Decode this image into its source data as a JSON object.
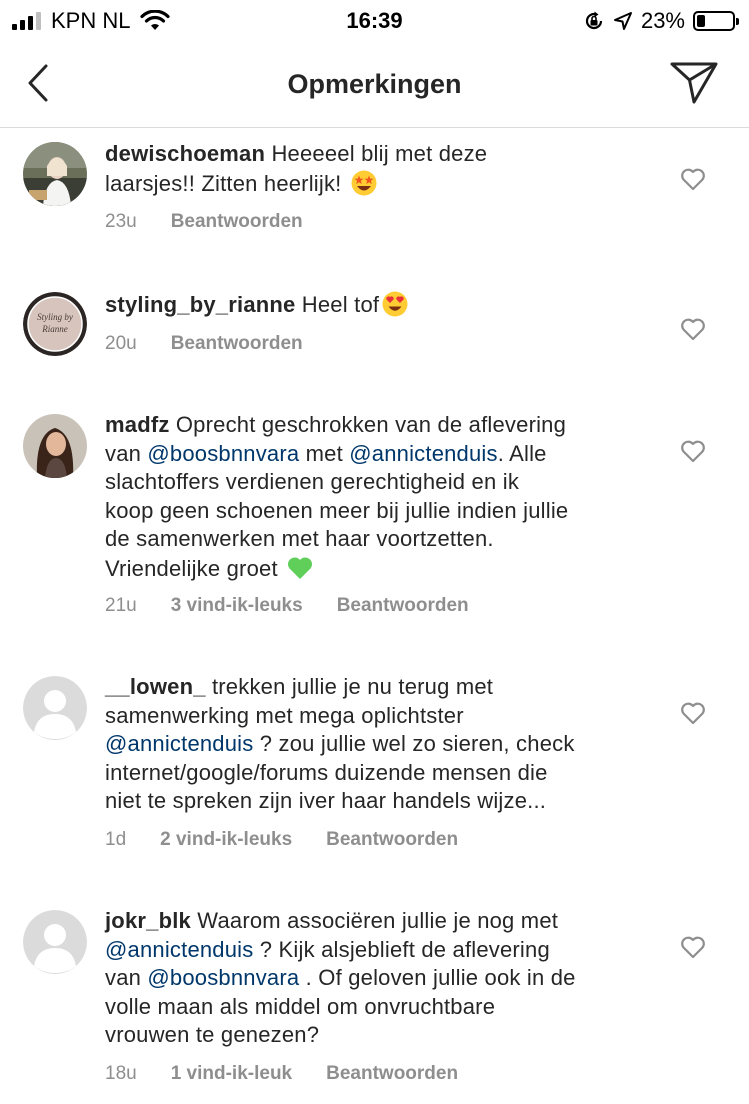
{
  "status_bar": {
    "carrier": "KPN NL",
    "time": "16:39",
    "battery_percent": "23%",
    "battery_level": 0.23,
    "icons": [
      "signal-icon",
      "wifi-icon",
      "orientation-lock-icon",
      "location-arrow-icon",
      "battery-icon"
    ]
  },
  "header": {
    "title": "Opmerkingen",
    "back_icon": "chevron-left-icon",
    "send_icon": "paper-plane-icon"
  },
  "comments": [
    {
      "username": "dewischoeman",
      "text_parts": [
        "Heeeeel blij met deze",
        "laarsjes!! Zitten heerlijk!"
      ],
      "emoji": "star-struck-emoji",
      "time": "23u",
      "likes": "",
      "reply_label": "Beantwoorden"
    },
    {
      "username": "styling_by_rianne",
      "text": "Heel tof",
      "emoji": "heart-eyes-emoji",
      "avatar_text": "Styling by Rianne",
      "time": "20u",
      "likes": "",
      "reply_label": "Beantwoorden"
    },
    {
      "username": "madfz",
      "line1": "Oprecht geschrokken van de aflevering",
      "line2_pre": "van",
      "mention1": "@boosbnnvara",
      "line2_mid": "met",
      "mention2": "@annictenduis",
      "line2_post": ". Alle",
      "line3": "slachtoffers verdienen gerechtigheid en ik",
      "line4": "koop geen schoenen meer bij jullie indien jullie",
      "line5": "de samenwerken met haar voortzetten.",
      "line6": "Vriendelijke groet",
      "emoji": "green-heart-emoji",
      "time": "21u",
      "likes": "3 vind-ik-leuks",
      "reply_label": "Beantwoorden"
    },
    {
      "username": "__lowen_",
      "line1": "trekken jullie je nu terug met",
      "line2": "samenwerking met mega oplichtster",
      "mention": "@annictenduis",
      "line3_post": "? zou jullie wel zo sieren, check",
      "line4": "internet/google/forums duizende mensen die",
      "line5": "niet te spreken zijn iver haar handels wijze...",
      "time": "1d",
      "likes": "2 vind-ik-leuks",
      "reply_label": "Beantwoorden"
    },
    {
      "username": "jokr_blk",
      "line1": "Waarom associëren jullie je nog met",
      "mention1": "@annictenduis",
      "line2_post": "? Kijk alsjeblieft de aflevering",
      "line3_pre": "van",
      "mention2": "@boosbnnvara",
      "line3_post": ". Of geloven jullie ook in de",
      "line4": "volle maan als middel om onvruchtbare",
      "line5": "vrouwen te genezen?",
      "time": "18u",
      "likes": "1 vind-ik-leuk",
      "reply_label": "Beantwoorden"
    }
  ],
  "colors": {
    "text": "#262626",
    "meta": "#8e8e8e",
    "mention": "#00376b",
    "divider": "#dbdbdb",
    "placeholder_avatar": "#dbdbdb"
  }
}
